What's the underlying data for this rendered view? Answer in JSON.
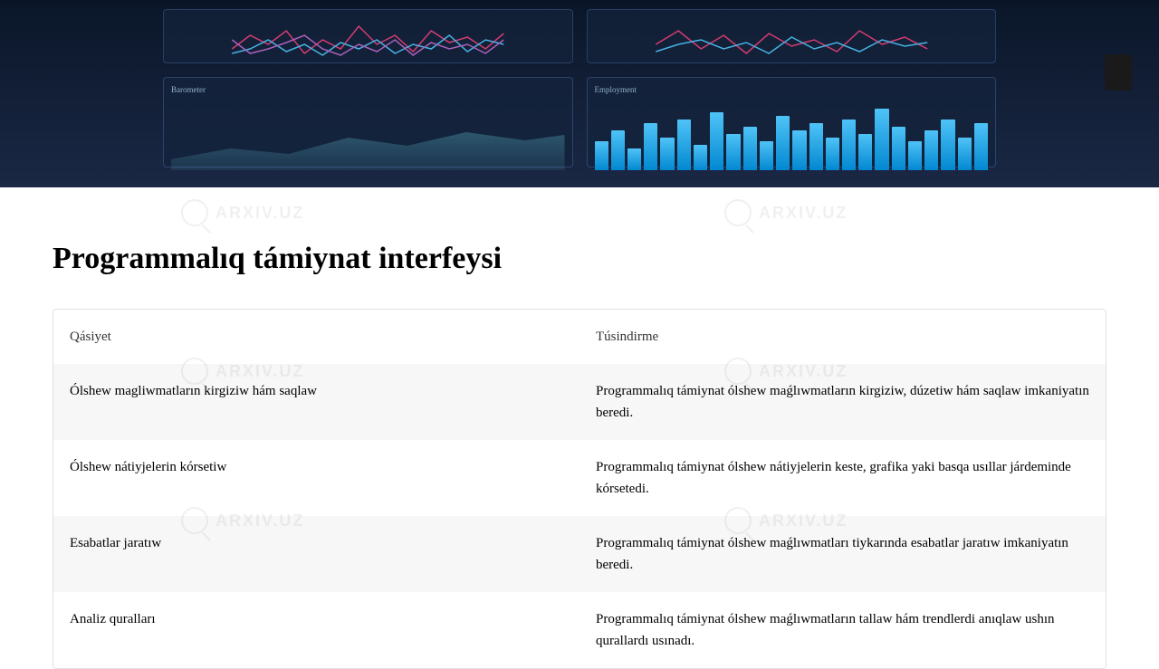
{
  "watermark": "ARXIV.UZ",
  "title": "Programmalıq támiynat interfeysi",
  "table": {
    "headers": [
      "Qásiyet",
      "Túsindirme"
    ],
    "rows": [
      {
        "property": "Ólshew magliwmatların kirgiziw hám saqlaw",
        "description": "Programmalıq támiynat ólshew maǵlıwmatların kirgiziw, dúzetiw hám saqlaw imkaniyatın beredi."
      },
      {
        "property": "Ólshew nátiyjelerin kórsetiw",
        "description": "Programmalıq támiynat ólshew nátiyjelerin keste, grafika yaki basqa usıllar járdeminde kórsetedi."
      },
      {
        "property": "Esabatlar jaratıw",
        "description": "Programmalıq támiynat ólshew maǵlıwmatları tiykarında esabatlar jaratıw imkaniyatın beredi."
      },
      {
        "property": "Analiz quralları",
        "description": "Programmalıq támiynat ólshew maǵlıwmatların tallaw hám trendlerdi anıqlaw ushın qurallardı usınadı."
      }
    ]
  }
}
